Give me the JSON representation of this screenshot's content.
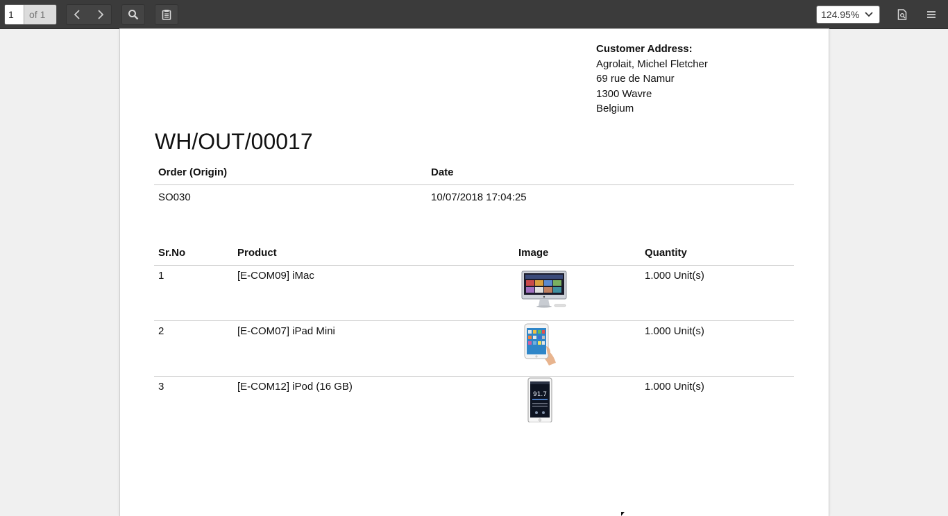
{
  "toolbar": {
    "page_number": "1",
    "page_count_label": "of 1",
    "zoom_value": "124.95%"
  },
  "document": {
    "customer_address": {
      "heading": "Customer Address:",
      "lines": [
        "Agrolait, Michel Fletcher",
        "69 rue de Namur",
        "1300 Wavre",
        "Belgium"
      ]
    },
    "title": "WH/OUT/00017",
    "order_table": {
      "headers": [
        "Order (Origin)",
        "Date"
      ],
      "origin": "SO030",
      "date": "10/07/2018 17:04:25"
    },
    "lines_table": {
      "headers": [
        "Sr.No",
        "Product",
        "Image",
        "Quantity"
      ],
      "rows": [
        {
          "sr": "1",
          "product": "[E-COM09] iMac",
          "image": "imac-image",
          "quantity": "1.000 Unit(s)"
        },
        {
          "sr": "2",
          "product": "[E-COM07] iPad Mini",
          "image": "ipad-mini-image",
          "quantity": "1.000 Unit(s)"
        },
        {
          "sr": "3",
          "product": "[E-COM12] iPod (16 GB)",
          "image": "ipod-image",
          "quantity": "1.000 Unit(s)"
        }
      ]
    }
  }
}
